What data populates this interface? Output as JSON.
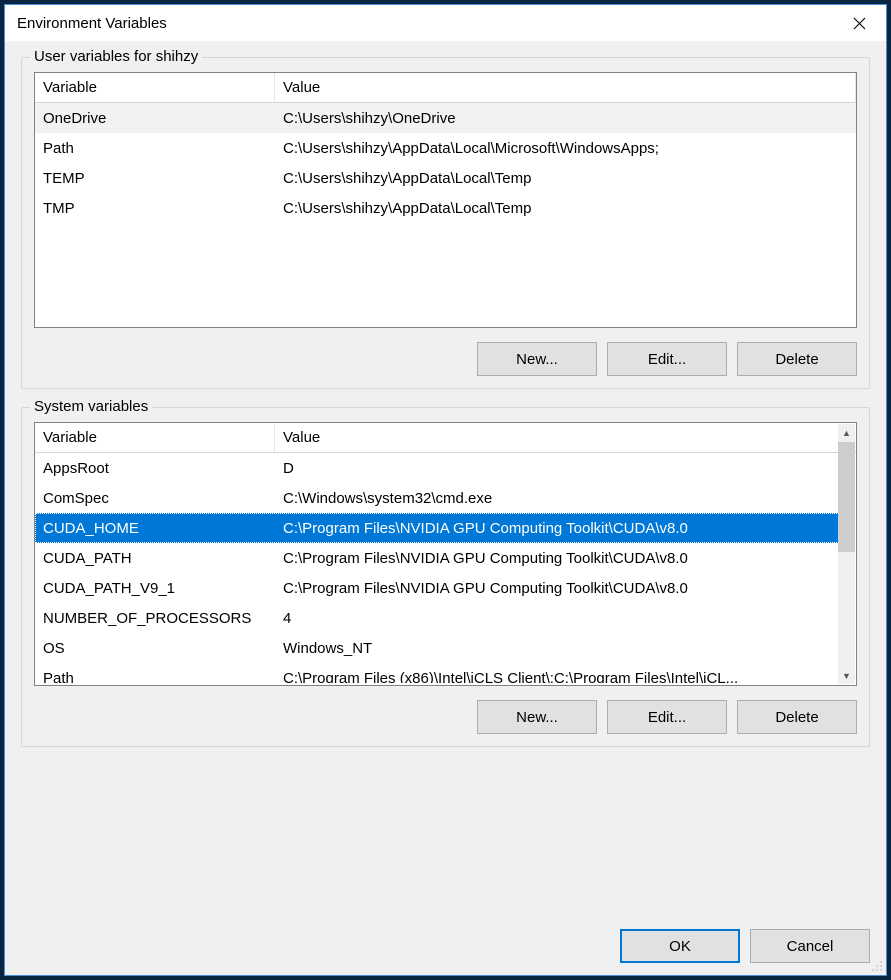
{
  "window": {
    "title": "Environment Variables"
  },
  "userGroup": {
    "label": "User variables for shihzy",
    "columns": {
      "var": "Variable",
      "val": "Value"
    },
    "rows": [
      {
        "var": "OneDrive",
        "val": "C:\\Users\\shihzy\\OneDrive",
        "alt": true
      },
      {
        "var": "Path",
        "val": "C:\\Users\\shihzy\\AppData\\Local\\Microsoft\\WindowsApps;"
      },
      {
        "var": "TEMP",
        "val": "C:\\Users\\shihzy\\AppData\\Local\\Temp"
      },
      {
        "var": "TMP",
        "val": "C:\\Users\\shihzy\\AppData\\Local\\Temp"
      }
    ],
    "buttons": {
      "new": "New...",
      "edit": "Edit...",
      "delete": "Delete"
    }
  },
  "sysGroup": {
    "label": "System variables",
    "columns": {
      "var": "Variable",
      "val": "Value"
    },
    "rows": [
      {
        "var": "AppsRoot",
        "val": "D"
      },
      {
        "var": "ComSpec",
        "val": "C:\\Windows\\system32\\cmd.exe"
      },
      {
        "var": "CUDA_HOME",
        "val": "C:\\Program Files\\NVIDIA GPU Computing Toolkit\\CUDA\\v8.0",
        "selected": true
      },
      {
        "var": "CUDA_PATH",
        "val": "C:\\Program Files\\NVIDIA GPU Computing Toolkit\\CUDA\\v8.0"
      },
      {
        "var": "CUDA_PATH_V9_1",
        "val": "C:\\Program Files\\NVIDIA GPU Computing Toolkit\\CUDA\\v8.0"
      },
      {
        "var": "NUMBER_OF_PROCESSORS",
        "val": "4"
      },
      {
        "var": "OS",
        "val": "Windows_NT"
      },
      {
        "var": "Path",
        "val": "C:\\Program Files (x86)\\Intel\\iCLS Client\\;C:\\Program Files\\Intel\\iCL..."
      }
    ],
    "buttons": {
      "new": "New...",
      "edit": "Edit...",
      "delete": "Delete"
    }
  },
  "dialogButtons": {
    "ok": "OK",
    "cancel": "Cancel"
  }
}
